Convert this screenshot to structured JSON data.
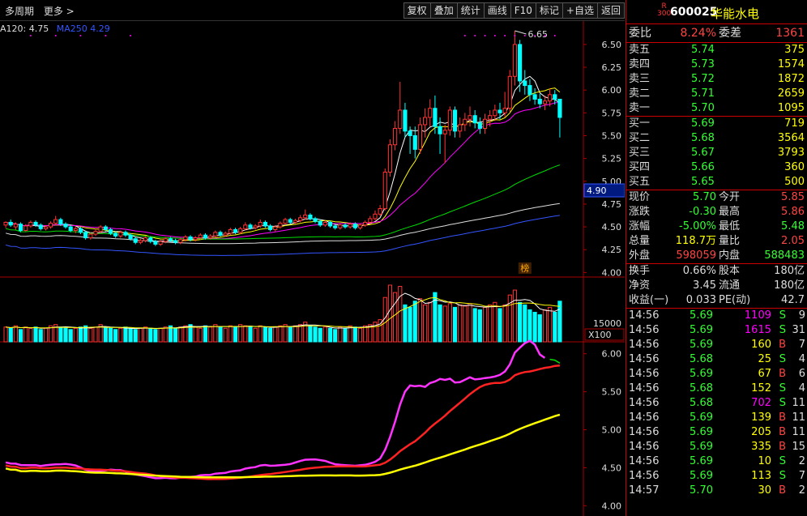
{
  "toolbar": {
    "left": [
      "多周期",
      "更多 >"
    ],
    "buttons": [
      "复权",
      "叠加",
      "统计",
      "画线",
      "F10",
      "标记",
      "+自选",
      "返回"
    ]
  },
  "ma_legend": [
    {
      "label": "A120: 4.75",
      "color": "#dddddd"
    },
    {
      "label": "MA250  4.29",
      "color": "#3355ff"
    }
  ],
  "price_axis": [
    "6.50",
    "6.25",
    "6.00",
    "5.75",
    "5.50",
    "5.25",
    "5.00",
    "4.75",
    "4.50",
    "4.25",
    "4.00"
  ],
  "price_label_current": "4.90",
  "high_marker": "6.65",
  "badge_mark": "榜",
  "volume_axis": [
    "15000",
    "X100"
  ],
  "ind_axis": [
    "6.00",
    "5.50",
    "5.00",
    "4.50",
    "4.00"
  ],
  "stock": {
    "badge_r": "R",
    "badge_num": "300",
    "code": "600025",
    "name": "华能水电"
  },
  "committee": {
    "label1": "委比",
    "v1": "8.24%",
    "label2": "委差",
    "v2": "1361"
  },
  "sells": [
    {
      "label": "卖五",
      "price": "5.74",
      "vol": "375"
    },
    {
      "label": "卖四",
      "price": "5.73",
      "vol": "1574"
    },
    {
      "label": "卖三",
      "price": "5.72",
      "vol": "1872"
    },
    {
      "label": "卖二",
      "price": "5.71",
      "vol": "2659"
    },
    {
      "label": "卖一",
      "price": "5.70",
      "vol": "1095"
    }
  ],
  "buys": [
    {
      "label": "买一",
      "price": "5.69",
      "vol": "719"
    },
    {
      "label": "买二",
      "price": "5.68",
      "vol": "3564"
    },
    {
      "label": "买三",
      "price": "5.67",
      "vol": "3793"
    },
    {
      "label": "买四",
      "price": "5.66",
      "vol": "360"
    },
    {
      "label": "买五",
      "price": "5.65",
      "vol": "500"
    }
  ],
  "quote": [
    {
      "l1": "现价",
      "v1": "5.70",
      "c1": "g",
      "l2": "今开",
      "v2": "5.85",
      "c2": "r"
    },
    {
      "l1": "涨跌",
      "v1": "-0.30",
      "c1": "g",
      "l2": "最高",
      "v2": "5.86",
      "c2": "r"
    },
    {
      "l1": "涨幅",
      "v1": "-5.00%",
      "c1": "g",
      "l2": "最低",
      "v2": "5.48",
      "c2": "g"
    },
    {
      "l1": "总量",
      "v1": "118.7万",
      "c1": "y",
      "l2": "量比",
      "v2": "2.05",
      "c2": "r"
    },
    {
      "l1": "外盘",
      "v1": "598059",
      "c1": "r",
      "l2": "内盘",
      "v2": "588483",
      "c2": "g"
    }
  ],
  "fundamentals": [
    {
      "l1": "换手",
      "v1": "0.66%",
      "l2": "股本",
      "v2": "180亿"
    },
    {
      "l1": "净资",
      "v1": "3.45",
      "l2": "流通",
      "v2": "180亿"
    },
    {
      "l1": "收益(一)",
      "v1": "0.033",
      "l2": "PE(动)",
      "v2": "42.7"
    }
  ],
  "ticks": [
    {
      "t": "14:56",
      "p": "5.69",
      "v": "1109",
      "vc": "m",
      "bs": "S",
      "n": "9"
    },
    {
      "t": "14:56",
      "p": "5.69",
      "v": "1615",
      "vc": "m",
      "bs": "S",
      "n": "31"
    },
    {
      "t": "14:56",
      "p": "5.69",
      "v": "160",
      "vc": "y",
      "bs": "B",
      "n": "7"
    },
    {
      "t": "14:56",
      "p": "5.68",
      "v": "25",
      "vc": "y",
      "bs": "S",
      "n": "4"
    },
    {
      "t": "14:56",
      "p": "5.69",
      "v": "67",
      "vc": "y",
      "bs": "B",
      "n": "6"
    },
    {
      "t": "14:56",
      "p": "5.68",
      "v": "152",
      "vc": "y",
      "bs": "S",
      "n": "4"
    },
    {
      "t": "14:56",
      "p": "5.68",
      "v": "702",
      "vc": "m",
      "bs": "S",
      "n": "11"
    },
    {
      "t": "14:56",
      "p": "5.69",
      "v": "139",
      "vc": "y",
      "bs": "B",
      "n": "11"
    },
    {
      "t": "14:56",
      "p": "5.69",
      "v": "205",
      "vc": "y",
      "bs": "B",
      "n": "11"
    },
    {
      "t": "14:56",
      "p": "5.69",
      "v": "335",
      "vc": "y",
      "bs": "B",
      "n": "15"
    },
    {
      "t": "14:56",
      "p": "5.69",
      "v": "10",
      "vc": "y",
      "bs": "S",
      "n": "2"
    },
    {
      "t": "14:56",
      "p": "5.69",
      "v": "113",
      "vc": "y",
      "bs": "S",
      "n": "7"
    },
    {
      "t": "14:57",
      "p": "5.70",
      "v": "30",
      "vc": "y",
      "bs": "B",
      "n": "2"
    }
  ],
  "chart_data": {
    "type": "candlestick",
    "price_range": [
      3.95,
      6.65
    ],
    "candles": [
      [
        4.52,
        4.55,
        4.49,
        4.56
      ],
      [
        4.55,
        4.52,
        4.5,
        4.58
      ],
      [
        4.5,
        4.53,
        4.47,
        4.55
      ],
      [
        4.53,
        4.46,
        4.44,
        4.55
      ],
      [
        4.46,
        4.51,
        4.45,
        4.53
      ],
      [
        4.51,
        4.55,
        4.49,
        4.57
      ],
      [
        4.55,
        4.52,
        4.5,
        4.57
      ],
      [
        4.52,
        4.48,
        4.46,
        4.54
      ],
      [
        4.48,
        4.5,
        4.46,
        4.52
      ],
      [
        4.5,
        4.54,
        4.48,
        4.56
      ],
      [
        4.54,
        4.58,
        4.52,
        4.62
      ],
      [
        4.58,
        4.53,
        4.51,
        4.6
      ],
      [
        4.53,
        4.5,
        4.48,
        4.55
      ],
      [
        4.5,
        4.46,
        4.44,
        4.52
      ],
      [
        4.46,
        4.48,
        4.43,
        4.5
      ],
      [
        4.48,
        4.44,
        4.42,
        4.5
      ],
      [
        4.44,
        4.38,
        4.36,
        4.46
      ],
      [
        4.38,
        4.42,
        4.36,
        4.44
      ],
      [
        4.42,
        4.45,
        4.4,
        4.48
      ],
      [
        4.45,
        4.5,
        4.43,
        4.52
      ],
      [
        4.5,
        4.47,
        4.45,
        4.52
      ],
      [
        4.47,
        4.43,
        4.41,
        4.49
      ],
      [
        4.43,
        4.4,
        4.38,
        4.45
      ],
      [
        4.4,
        4.44,
        4.38,
        4.46
      ],
      [
        4.44,
        4.41,
        4.39,
        4.46
      ],
      [
        4.41,
        4.37,
        4.35,
        4.43
      ],
      [
        4.37,
        4.33,
        4.31,
        4.39
      ],
      [
        4.33,
        4.35,
        4.31,
        4.37
      ],
      [
        4.35,
        4.38,
        4.33,
        4.4
      ],
      [
        4.38,
        4.34,
        4.32,
        4.4
      ],
      [
        4.34,
        4.31,
        4.29,
        4.36
      ],
      [
        4.31,
        4.34,
        4.29,
        4.36
      ],
      [
        4.34,
        4.37,
        4.32,
        4.39
      ],
      [
        4.37,
        4.35,
        4.33,
        4.39
      ],
      [
        4.35,
        4.33,
        4.31,
        4.37
      ],
      [
        4.33,
        4.36,
        4.31,
        4.38
      ],
      [
        4.36,
        4.39,
        4.34,
        4.41
      ],
      [
        4.39,
        4.36,
        4.34,
        4.41
      ],
      [
        4.36,
        4.38,
        4.34,
        4.4
      ],
      [
        4.38,
        4.41,
        4.36,
        4.43
      ],
      [
        4.41,
        4.38,
        4.36,
        4.43
      ],
      [
        4.38,
        4.4,
        4.36,
        4.42
      ],
      [
        4.4,
        4.44,
        4.38,
        4.46
      ],
      [
        4.44,
        4.41,
        4.39,
        4.46
      ],
      [
        4.41,
        4.43,
        4.39,
        4.45
      ],
      [
        4.43,
        4.47,
        4.41,
        4.49
      ],
      [
        4.47,
        4.44,
        4.42,
        4.49
      ],
      [
        4.44,
        4.48,
        4.42,
        4.5
      ],
      [
        4.48,
        4.52,
        4.46,
        4.55
      ],
      [
        4.52,
        4.49,
        4.47,
        4.54
      ],
      [
        4.49,
        4.51,
        4.47,
        4.53
      ],
      [
        4.51,
        4.55,
        4.49,
        4.58
      ],
      [
        4.55,
        4.51,
        4.49,
        4.57
      ],
      [
        4.51,
        4.47,
        4.45,
        4.53
      ],
      [
        4.47,
        4.5,
        4.45,
        4.52
      ],
      [
        4.5,
        4.54,
        4.48,
        4.56
      ],
      [
        4.54,
        4.58,
        4.52,
        4.6
      ],
      [
        4.58,
        4.55,
        4.53,
        4.6
      ],
      [
        4.55,
        4.57,
        4.53,
        4.59
      ],
      [
        4.57,
        4.6,
        4.55,
        4.63
      ],
      [
        4.6,
        4.63,
        4.58,
        4.69
      ],
      [
        4.63,
        4.59,
        4.57,
        4.65
      ],
      [
        4.59,
        4.56,
        4.54,
        4.61
      ],
      [
        4.56,
        4.52,
        4.5,
        4.58
      ],
      [
        4.52,
        4.55,
        4.5,
        4.57
      ],
      [
        4.55,
        4.51,
        4.49,
        4.57
      ],
      [
        4.51,
        4.49,
        4.47,
        4.53
      ],
      [
        4.49,
        4.52,
        4.47,
        4.54
      ],
      [
        4.52,
        4.5,
        4.48,
        4.54
      ],
      [
        4.5,
        4.53,
        4.48,
        4.55
      ],
      [
        4.53,
        4.49,
        4.47,
        4.55
      ],
      [
        4.49,
        4.52,
        4.47,
        4.54
      ],
      [
        4.52,
        4.55,
        4.5,
        4.57
      ],
      [
        4.55,
        4.59,
        4.53,
        4.62
      ],
      [
        4.59,
        4.64,
        4.57,
        4.68
      ],
      [
        4.64,
        4.7,
        4.62,
        4.74
      ],
      [
        4.7,
        5.1,
        4.68,
        5.14
      ],
      [
        5.1,
        5.4,
        5.05,
        5.46
      ],
      [
        5.4,
        5.58,
        5.34,
        5.66
      ],
      [
        5.58,
        5.78,
        5.52,
        6.09
      ],
      [
        5.78,
        5.55,
        5.48,
        5.86
      ],
      [
        5.55,
        5.5,
        5.3,
        5.6
      ],
      [
        5.5,
        5.35,
        5.25,
        5.6
      ],
      [
        5.35,
        5.62,
        5.3,
        5.7
      ],
      [
        5.62,
        5.7,
        5.48,
        5.8
      ],
      [
        5.7,
        5.8,
        5.6,
        5.9
      ],
      [
        5.8,
        5.6,
        5.52,
        5.94
      ],
      [
        5.6,
        5.52,
        5.3,
        5.7
      ],
      [
        5.52,
        5.56,
        5.2,
        5.62
      ],
      [
        5.56,
        5.78,
        5.5,
        5.82
      ],
      [
        5.78,
        5.55,
        5.48,
        5.82
      ],
      [
        5.55,
        5.62,
        5.48,
        5.7
      ],
      [
        5.62,
        5.68,
        5.55,
        5.75
      ],
      [
        5.68,
        5.72,
        5.6,
        5.82
      ],
      [
        5.72,
        5.64,
        5.58,
        5.78
      ],
      [
        5.64,
        5.58,
        5.52,
        5.7
      ],
      [
        5.58,
        5.68,
        5.52,
        5.74
      ],
      [
        5.68,
        5.72,
        5.6,
        5.78
      ],
      [
        5.72,
        5.78,
        5.66,
        5.84
      ],
      [
        5.78,
        5.75,
        5.68,
        5.86
      ],
      [
        5.75,
        5.8,
        5.7,
        5.98
      ],
      [
        5.8,
        6.15,
        5.76,
        6.22
      ],
      [
        6.15,
        6.5,
        6.05,
        6.65
      ],
      [
        6.5,
        6.1,
        5.98,
        6.55
      ],
      [
        6.1,
        6.05,
        5.95,
        6.22
      ],
      [
        6.05,
        5.95,
        5.88,
        6.12
      ],
      [
        5.95,
        5.9,
        5.84,
        6.02
      ],
      [
        5.9,
        5.85,
        5.8,
        5.96
      ],
      [
        5.85,
        5.88,
        5.78,
        5.94
      ],
      [
        5.88,
        5.95,
        5.82,
        6.02
      ],
      [
        5.95,
        5.9,
        5.84,
        6.0
      ],
      [
        5.9,
        5.7,
        5.48,
        5.86
      ]
    ],
    "volumes": [
      12,
      11,
      13,
      10,
      12,
      11,
      12,
      10,
      11,
      13,
      14,
      12,
      11,
      10,
      11,
      12,
      13,
      11,
      12,
      14,
      12,
      11,
      10,
      11,
      12,
      11,
      10,
      11,
      12,
      11,
      10,
      11,
      12,
      13,
      11,
      12,
      13,
      14,
      12,
      11,
      13,
      12,
      14,
      12,
      11,
      13,
      12,
      14,
      13,
      12,
      11,
      13,
      12,
      11,
      12,
      13,
      14,
      12,
      13,
      14,
      16,
      13,
      12,
      11,
      12,
      11,
      10,
      12,
      11,
      13,
      12,
      11,
      13,
      14,
      16,
      18,
      36,
      46,
      40,
      45,
      30,
      28,
      33,
      35,
      30,
      32,
      40,
      30,
      29,
      31,
      28,
      30,
      29,
      31,
      27,
      26,
      28,
      30,
      32,
      27,
      30,
      38,
      42,
      32,
      30,
      26,
      24,
      22,
      26,
      28,
      24,
      33
    ],
    "ma_close_window": [
      5,
      10,
      20,
      60,
      120,
      250
    ],
    "ma_colors": [
      "#ffffff",
      "#ffff00",
      "#ff00ff",
      "#00dd00",
      "#dddddd",
      "#3355ff"
    ]
  }
}
